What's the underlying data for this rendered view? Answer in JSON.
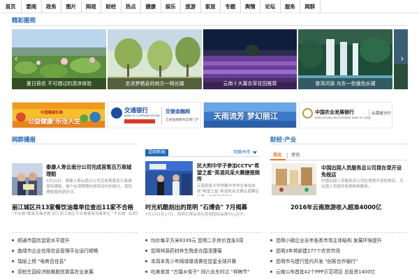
{
  "nav": [
    "首页",
    "要闻",
    "政务",
    "图片",
    "网视",
    "财经",
    "热点",
    "健康",
    "娱乐",
    "旅游",
    "家居",
    "专题",
    "舆情",
    "论坛",
    "服务",
    "网群"
  ],
  "gallery": {
    "title": "精彩图视",
    "photos": [
      {
        "caption": "夏日荷花 不可错过的清凉体验"
      },
      {
        "caption": "走进梦栖息的地方一明光镇"
      },
      {
        "caption": "云南十大薰衣草花田推荐"
      },
      {
        "caption": "普洱河源 乌东一色银色长裙"
      }
    ],
    "arrow_left": "‹",
    "arrow_right": "›"
  },
  "ads": {
    "a1": {
      "line1": "中国健康形象",
      "line2": "公益健康 乐活人生"
    },
    "a2": {
      "name": "交通银行",
      "sub": "BANK OF COMMUNICATIONS",
      "right1": "交银金融网",
      "right2": "交通金融服务官网门户"
    },
    "a3": {
      "text": "天雨流芳 梦幻丽江"
    },
    "a4": {
      "name": "中国农业发展银行",
      "sub": "AGRICULTURAL DEVELOPMENT BANK OF CHINA",
      "branch": "云南省分行"
    }
  },
  "left": {
    "title": "网群播报",
    "headline": {
      "title": "泰康人寿云南分公司完成首笔百万商城理赔",
      "desc": "5月25日，泰康人寿云南分公司完成首笔百万商城保险理赔，客户在保障期内得到及时的赔付，保险理赔服务获好评。"
    },
    "big_title": "丽江城区共13家餐饮油毒单位查出11家不合格",
    "desc": "\"不合格\"餐具消毒进展 丽江丽江城区不合格餐具消毒单位 \"不合格\" 后续跟进处理。",
    "list": [
      "顺通市国信监管水平提升",
      "曲靖市企业信用信息管理平台运行顺畅",
      "瑞丽上榜 \"电商百佳县\"",
      "双柏生园经济助推脱贫致富农业发展"
    ]
  },
  "mid": {
    "tag": "昆明新闻",
    "switch": "切换州市",
    "headline": {
      "title": "民大附中学子参加CCTV\"希望之星\"英语风采大赛捷报频传",
      "desc": "云南民族大学附属中学学生参加央视\"希望之星\"英语风采大赛云南赛区比赛，选手获奖频传。"
    },
    "big_title": "时光机酷刻出的昆明 \"石博会\" 7月揭幕",
    "desc": "7月10日至17日，昆明石博会将在昆明国际会展中心召开。",
    "list": [
      "均价每平方米8339元 昆明二手房价连涨3周",
      "昆明祥源药材养生院承办国涅康菊",
      "本周末青少年网球邀请赛在昆星全球开赛",
      "吃美食赏 \"古镇乡街子\" 同六去东村过 \"祥梅节\""
    ]
  },
  "right": {
    "title": "财经·产业",
    "tabs": [
      "视点",
      "资讯"
    ],
    "headline": {
      "title": "中国出国人员服务总公司昆在昆开设免税店",
      "desc": "中国出国人员服务总公司在昆明开设免税店，为出国人员提供免税购物服务。"
    },
    "big_title": "2016年云南旅游收入超准4000亿",
    "list": [
      "昆明小微企业去年各类市场主体结构 发展环境提升",
      "昆明3年将新建277个农贸市场",
      "昆明市与建行签约开发 \"创客合作银行\"",
      "云南公布首批42个PPP示范项目 总投资1400亿"
    ]
  },
  "colors": {
    "nav_text": "#1d1d1d",
    "accent": "#1f67b8",
    "orange": "#e47820",
    "divider": "#d9d9d9"
  }
}
